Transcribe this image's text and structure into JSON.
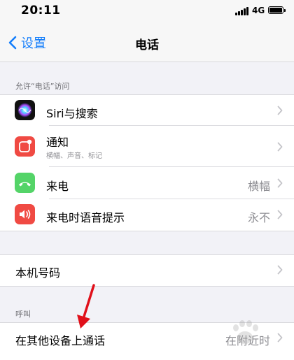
{
  "status_bar": {
    "time": "20:11",
    "network": "4G"
  },
  "nav": {
    "back_label": "设置",
    "title": "电话"
  },
  "sections": {
    "allow_access_header": "允许“电话”访问",
    "calls_header": "呼叫"
  },
  "access_items": [
    {
      "label": "Siri与搜索",
      "icon": "siri-icon"
    },
    {
      "label": "通知",
      "sublabel": "横幅、声音、标记",
      "icon": "notifications-icon"
    },
    {
      "label": "来电",
      "value": "横幅",
      "icon": "incoming-call-icon"
    },
    {
      "label": "来电时语音提示",
      "value": "永不",
      "icon": "announce-calls-icon"
    }
  ],
  "my_number": {
    "label": "本机号码"
  },
  "calls_items": [
    {
      "label": "在其他设备上通话",
      "value": "在附近时"
    }
  ],
  "colors": {
    "accent": "#147efb",
    "notifications_icon_bg": "#f04a43",
    "incoming_call_icon_bg": "#54d468",
    "announce_icon_bg": "#f04a43",
    "annotation_arrow": "#e0101a"
  }
}
